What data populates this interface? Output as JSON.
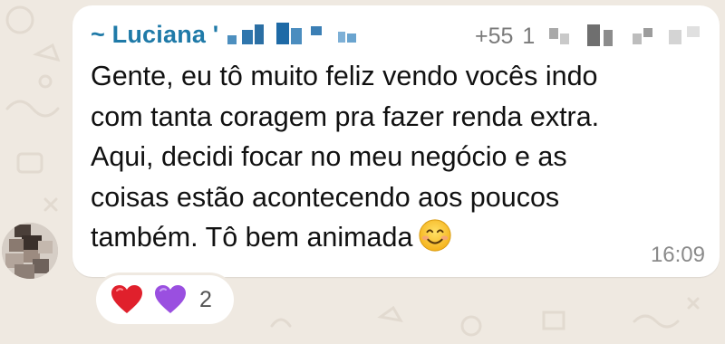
{
  "message": {
    "sender_name": "~ Luciana '",
    "sender_phone_prefix": "+55",
    "sender_phone_digit": "1",
    "text_lines": [
      "Gente, eu tô muito feliz vendo vocês indo",
      "com tanta coragem pra fazer renda extra.",
      "Aqui, decidi focar no meu negócio e as",
      "coisas estão acontecendo aos poucos",
      "também. Tô bem animada"
    ],
    "trailing_emoji": "smiling-face-icon",
    "time": "16:09"
  },
  "reactions": {
    "emojis": [
      "red-heart-icon",
      "purple-heart-icon"
    ],
    "count": "2"
  },
  "colors": {
    "sender_name": "#1f7aa8",
    "background": "#efe9e1",
    "bubble": "#ffffff"
  }
}
